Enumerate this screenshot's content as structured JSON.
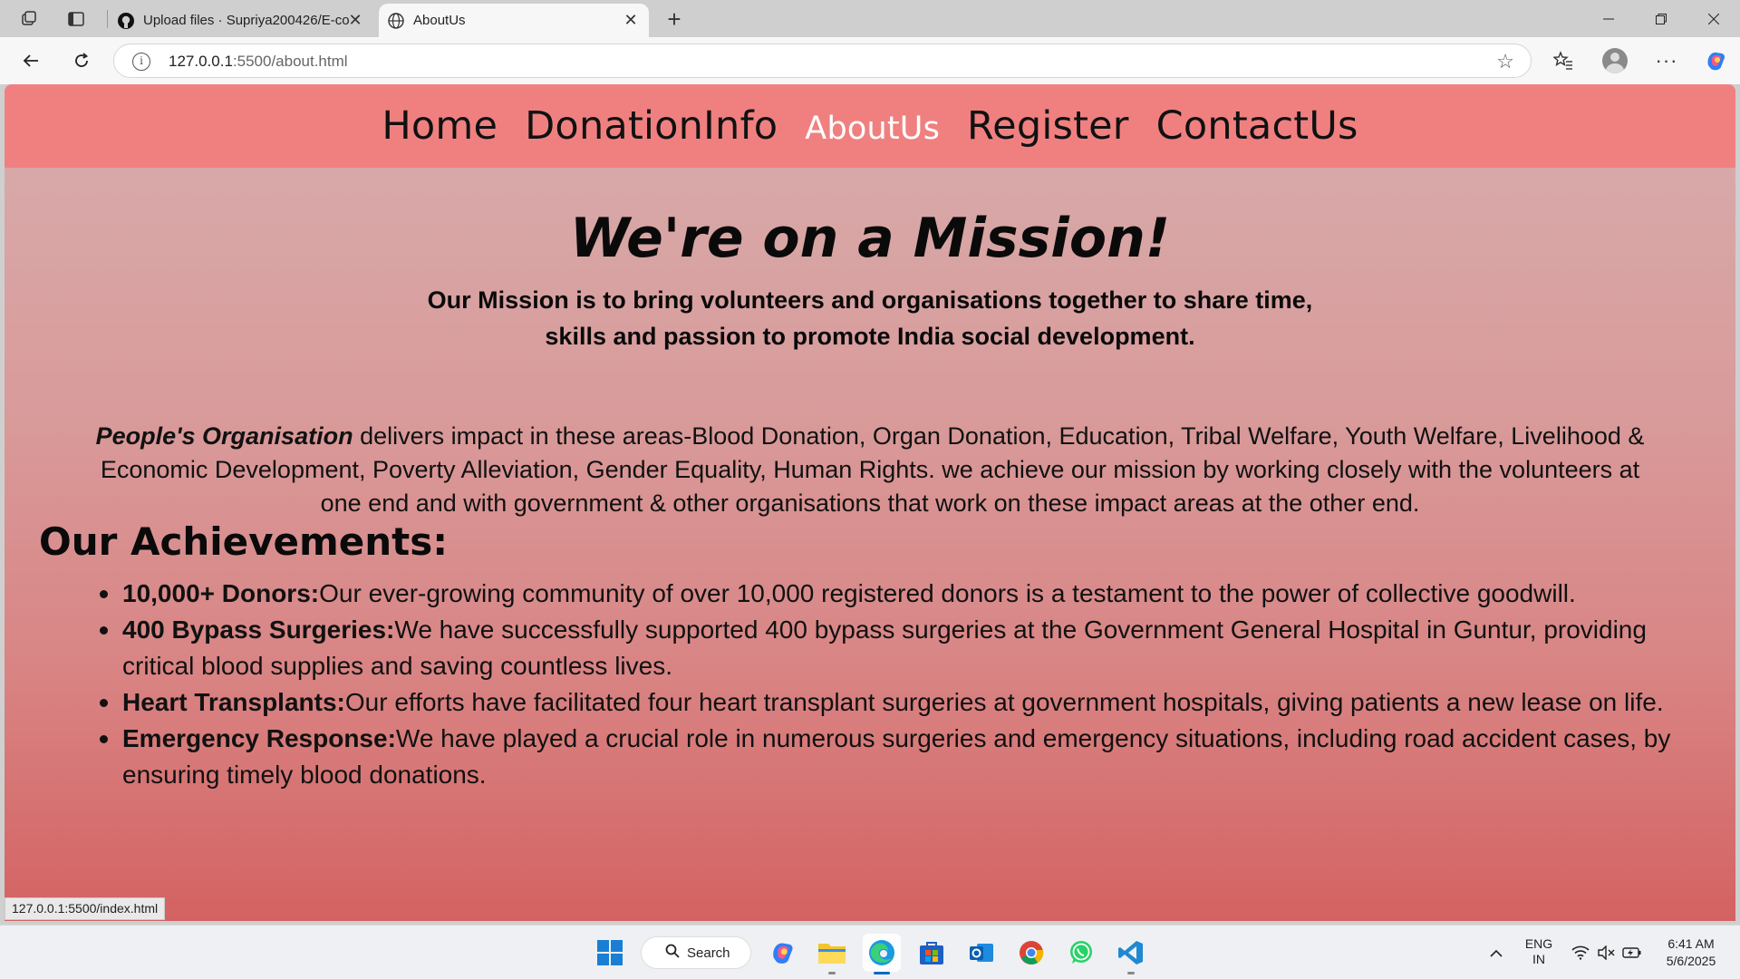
{
  "browser": {
    "tabs": [
      {
        "label": "Upload files · Supriya200426/E-co",
        "icon": "github-icon",
        "active": false
      },
      {
        "label": "AboutUs",
        "icon": "globe-icon",
        "active": true
      }
    ],
    "address": {
      "host": "127.0.0.1",
      "path": ":5500/about.html"
    },
    "status_url": "127.0.0.1:5500/index.html"
  },
  "site": {
    "nav": [
      {
        "label": "Home",
        "current": false
      },
      {
        "label": "DonationInfo",
        "current": false
      },
      {
        "label": "AboutUs",
        "current": true
      },
      {
        "label": "Register",
        "current": false
      },
      {
        "label": "ContactUs",
        "current": false
      }
    ],
    "mission_title": "We're on a Mission!",
    "mission_line1": "Our Mission is to bring volunteers and organisations together to share time,",
    "mission_line2": "skills and passion to promote India social development.",
    "impact_org": "People's Organisation",
    "impact_text": " delivers impact in these areas-Blood Donation, Organ Donation, Education, Tribal Welfare, Youth Welfare, Livelihood & Economic Development, Poverty Alleviation, Gender Equality, Human Rights. we achieve our mission by working closely with the volunteers at one end and with government & other organisations that work on these impact areas at the other end.",
    "achievements_title": "Our Achievements:",
    "achievements": [
      {
        "title": "10,000+ Donors:",
        "text": "Our ever-growing community of over 10,000 registered donors is a testament to the power of collective goodwill."
      },
      {
        "title": "400 Bypass Surgeries:",
        "text": "We have successfully supported 400 bypass surgeries at the Government General Hospital in Guntur, providing critical blood supplies and saving countless lives."
      },
      {
        "title": "Heart Transplants:",
        "text": "Our efforts have facilitated four heart transplant surgeries at government hospitals, giving patients a new lease on life."
      },
      {
        "title": "Emergency Response:",
        "text": "We have played a crucial role in numerous surgeries and emergency situations, including road accident cases, by ensuring timely blood donations."
      }
    ],
    "colors": {
      "nav_bg": "#f08080",
      "nav_current": "#ffffff",
      "bg_top": "#d8adad",
      "bg_bottom": "#d46262"
    }
  },
  "taskbar": {
    "search_label": "Search",
    "apps": [
      "start-icon",
      "copilot-icon",
      "file-explorer-icon",
      "edge-icon",
      "store-icon",
      "outlook-icon",
      "chrome-icon",
      "whatsapp-icon",
      "vscode-icon"
    ],
    "lang_line1": "ENG",
    "lang_line2": "IN",
    "time": "6:41 AM",
    "date": "5/6/2025"
  }
}
